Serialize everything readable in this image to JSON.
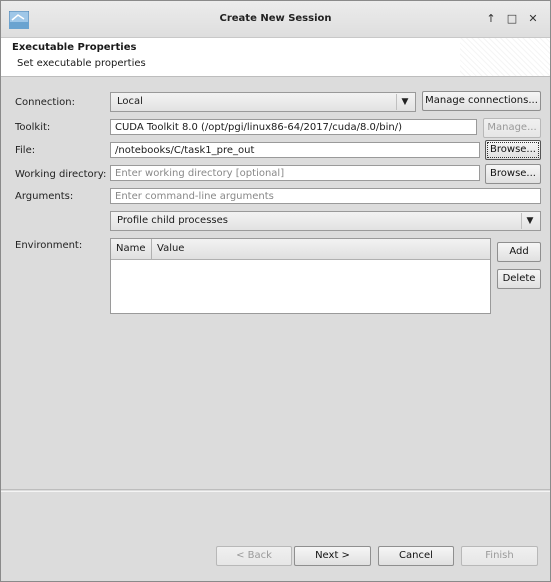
{
  "window": {
    "title": "Create New Session"
  },
  "banner": {
    "title": "Executable Properties",
    "subtitle": "Set executable properties"
  },
  "form": {
    "connection": {
      "label": "Connection:",
      "value": "Local",
      "manage_button": "Manage connections..."
    },
    "toolkit": {
      "label": "Toolkit:",
      "value": "CUDA Toolkit 8.0 (/opt/pgi/linux86-64/2017/cuda/8.0/bin/)",
      "manage_button": "Manage..."
    },
    "file": {
      "label": "File:",
      "value": "/notebooks/C/task1_pre_out",
      "browse_button": "Browse..."
    },
    "working_directory": {
      "label": "Working directory:",
      "placeholder": "Enter working directory [optional]",
      "browse_button": "Browse..."
    },
    "arguments": {
      "label": "Arguments:",
      "placeholder": "Enter command-line arguments"
    },
    "profile_child": {
      "value": "Profile child processes"
    },
    "environment": {
      "label": "Environment:",
      "columns": [
        "Name",
        "Value"
      ],
      "add_button": "Add",
      "delete_button": "Delete"
    }
  },
  "footer": {
    "back": "< Back",
    "next": "Next >",
    "cancel": "Cancel",
    "finish": "Finish"
  }
}
